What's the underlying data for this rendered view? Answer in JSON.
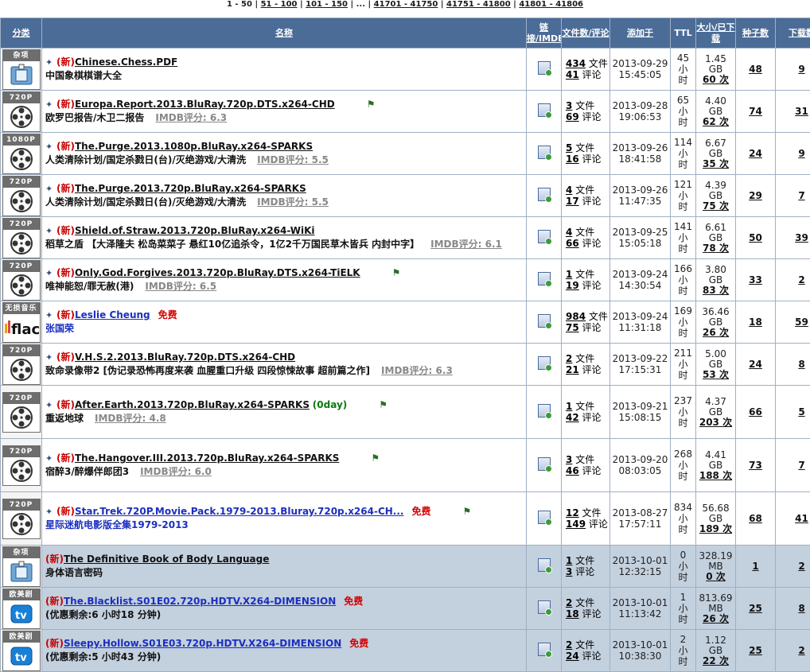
{
  "pager": {
    "current": "1 - 50",
    "links": [
      "51 - 100",
      "101 - 150"
    ],
    "ellipsis": "...",
    "tail_links": [
      "41701 - 41750",
      "41751 - 41800",
      "41801 - 41806"
    ]
  },
  "headers": {
    "category": "分类",
    "name": "名称",
    "link": "链接/IMDB",
    "files": "文件数/评论",
    "added": "添加于",
    "ttl": "TTL",
    "size": "大小/已下载",
    "seeders": "种子数",
    "downloads": "下载数"
  },
  "labels": {
    "new": "新",
    "files_unit": "文件",
    "comments_unit": "评论",
    "times_unit": "次",
    "free": "免费",
    "ttl_unit": "小时"
  },
  "rows": [
    {
      "cat": "杂项",
      "icon": "misc-icon",
      "title": "Chinese.Chess.PDF",
      "subtitle": "中国象棋棋谱大全",
      "imdb": "",
      "files": "434",
      "comments": "41",
      "date": "2013-09-29",
      "time": "15:45:05",
      "ttl": "45",
      "size": "1.45",
      "unit": "GB",
      "done": "60",
      "seeders": "48",
      "downloads": "9",
      "style": "r1",
      "bm": false
    },
    {
      "cat": "720P",
      "icon": "film-reel-icon",
      "title": "Europa.Report.2013.BluRay.720p.DTS.x264-CHD",
      "subtitle": "欧罗巴报告/木卫二报告",
      "imdb": "IMDB评分: 6.3",
      "files": "3",
      "comments": "69",
      "date": "2013-09-28",
      "time": "19:06:53",
      "ttl": "65",
      "size": "4.40",
      "unit": "GB",
      "done": "62",
      "seeders": "74",
      "downloads": "31",
      "style": "r1",
      "bm": true
    },
    {
      "cat": "1080P",
      "icon": "film-reel-icon",
      "title": "The.Purge.2013.1080p.BluRay.x264-SPARKS",
      "subtitle": "人类清除计划/国定杀戮日(台)/灭绝游戏/大清洗",
      "imdb": "IMDB评分: 5.5",
      "files": "5",
      "comments": "16",
      "date": "2013-09-26",
      "time": "18:41:58",
      "ttl": "114",
      "size": "6.67",
      "unit": "GB",
      "done": "35",
      "seeders": "24",
      "downloads": "9",
      "style": "r1",
      "bm": false
    },
    {
      "cat": "720P",
      "icon": "film-reel-icon",
      "title": "The.Purge.2013.720p.BluRay.x264-SPARKS",
      "subtitle": "人类清除计划/国定杀戮日(台)/灭绝游戏/大清洗",
      "imdb": "IMDB评分: 5.5",
      "files": "4",
      "comments": "17",
      "date": "2013-09-26",
      "time": "11:47:35",
      "ttl": "121",
      "size": "4.39",
      "unit": "GB",
      "done": "75",
      "seeders": "29",
      "downloads": "7",
      "style": "r1",
      "bm": false
    },
    {
      "cat": "720P",
      "icon": "film-reel-icon",
      "title": "Shield.of.Straw.2013.720p.BluRay.x264-WiKi",
      "subtitle": "稻草之盾 【大泽隆夫 松岛菜菜子 悬红10亿追杀令，1亿2千万国民草木皆兵 内封中字】",
      "imdb": "IMDB评分: 6.1",
      "files": "4",
      "comments": "66",
      "date": "2013-09-25",
      "time": "15:05:18",
      "ttl": "141",
      "size": "6.61",
      "unit": "GB",
      "done": "78",
      "seeders": "50",
      "downloads": "39",
      "style": "r1",
      "bm": false
    },
    {
      "cat": "720P",
      "icon": "film-reel-icon",
      "title": "Only.God.Forgives.2013.720p.BluRay.DTS.x264-TiELK",
      "subtitle": "唯神能恕/罪无赦(港)",
      "imdb": "IMDB评分: 6.5",
      "files": "1",
      "comments": "19",
      "date": "2013-09-24",
      "time": "14:30:54",
      "ttl": "166",
      "size": "3.80",
      "unit": "GB",
      "done": "83",
      "seeders": "33",
      "downloads": "2",
      "style": "r1",
      "bm": true
    },
    {
      "cat": "无损音乐",
      "icon": "flac-icon",
      "title": "Leslie Cheung",
      "subtitle": "张国荣",
      "imdb": "",
      "free": true,
      "blue": true,
      "files": "984",
      "comments": "75",
      "date": "2013-09-24",
      "time": "11:31:18",
      "ttl": "169",
      "size": "36.46",
      "unit": "GB",
      "done": "26",
      "seeders": "18",
      "downloads": "59",
      "style": "r1",
      "bm": false
    },
    {
      "cat": "720P",
      "icon": "film-reel-icon",
      "title": "V.H.S.2.2013.BluRay.720p.DTS.x264-CHD",
      "subtitle": "致命录像带2 [伪记录恐怖再度来袭 血腥重口升级 四段惊悚故事 超前篇之作]",
      "imdb": "IMDB评分: 6.3",
      "files": "2",
      "comments": "21",
      "date": "2013-09-22",
      "time": "17:15:31",
      "ttl": "211",
      "size": "5.00",
      "unit": "GB",
      "done": "53",
      "seeders": "24",
      "downloads": "8",
      "style": "r1",
      "bm": false
    },
    {
      "cat": "720P",
      "icon": "film-reel-icon",
      "title": "After.Earth.2013.720p.BluRay.x264-SPARKS",
      "zeroday": "(0day)",
      "subtitle": "重返地球",
      "imdb": "IMDB评分: 4.8",
      "files": "1",
      "comments": "42",
      "date": "2013-09-21",
      "time": "15:08:15",
      "ttl": "237",
      "size": "4.37",
      "unit": "GB",
      "done": "203",
      "seeders": "66",
      "downloads": "5",
      "style": "r1",
      "bm": true
    },
    {
      "cat": "720P",
      "icon": "film-reel-icon",
      "title": "The.Hangover.III.2013.720p.BluRay.x264-SPARKS",
      "subtitle": "宿醉3/醉爆伴郎团3",
      "imdb": "IMDB评分: 6.0",
      "files": "3",
      "comments": "46",
      "date": "2013-09-20",
      "time": "08:03:05",
      "ttl": "268",
      "size": "4.41",
      "unit": "GB",
      "done": "188",
      "seeders": "73",
      "downloads": "7",
      "style": "r1",
      "bm": true
    },
    {
      "cat": "720P",
      "icon": "film-reel-icon",
      "title": "Star.Trek.720P.Movie.Pack.1979-2013.Bluray.720p.x264-CH...",
      "subtitle": "星际迷航电影版全集1979-2013",
      "imdb": "",
      "free": true,
      "blue": true,
      "files": "12",
      "comments": "149",
      "date": "2013-08-27",
      "time": "17:57:11",
      "ttl": "834",
      "size": "56.68",
      "unit": "GB",
      "done": "189",
      "seeders": "68",
      "downloads": "41",
      "style": "r1",
      "bm": true
    },
    {
      "cat": "杂项",
      "icon": "misc-icon",
      "title": "The Definitive Book of Body Language",
      "subtitle": "身体语言密码",
      "imdb": "",
      "nopin": true,
      "files": "1",
      "comments": "3",
      "date": "2013-10-01",
      "time": "12:32:15",
      "ttl": "0",
      "size": "328.19",
      "unit": "MB",
      "done": "0",
      "seeders": "1",
      "downloads": "2",
      "style": "r2",
      "bm": false
    },
    {
      "cat": "欧美剧",
      "icon": "tv-icon",
      "title": "The.Blacklist.S01E02.720p.HDTV.X264-DIMENSION",
      "subtitle": "(优惠剩余:6 小时18 分钟)",
      "imdb": "",
      "nopin": true,
      "free": true,
      "blue": true,
      "files": "2",
      "comments": "18",
      "date": "2013-10-01",
      "time": "11:13:42",
      "ttl": "1",
      "size": "813.69",
      "unit": "MB",
      "done": "26",
      "seeders": "25",
      "downloads": "8",
      "style": "r2",
      "bm": false
    },
    {
      "cat": "欧美剧",
      "icon": "tv-icon",
      "title": "Sleepy.Hollow.S01E03.720p.HDTV.X264-DIMENSION",
      "subtitle": "(优惠剩余:5 小时43 分钟)",
      "imdb": "",
      "nopin": true,
      "free": true,
      "blue": true,
      "files": "2",
      "comments": "24",
      "date": "2013-10-01",
      "time": "10:38:30",
      "ttl": "2",
      "size": "1.12",
      "unit": "GB",
      "done": "22",
      "seeders": "25",
      "downloads": "2",
      "style": "r2",
      "bm": false
    }
  ]
}
